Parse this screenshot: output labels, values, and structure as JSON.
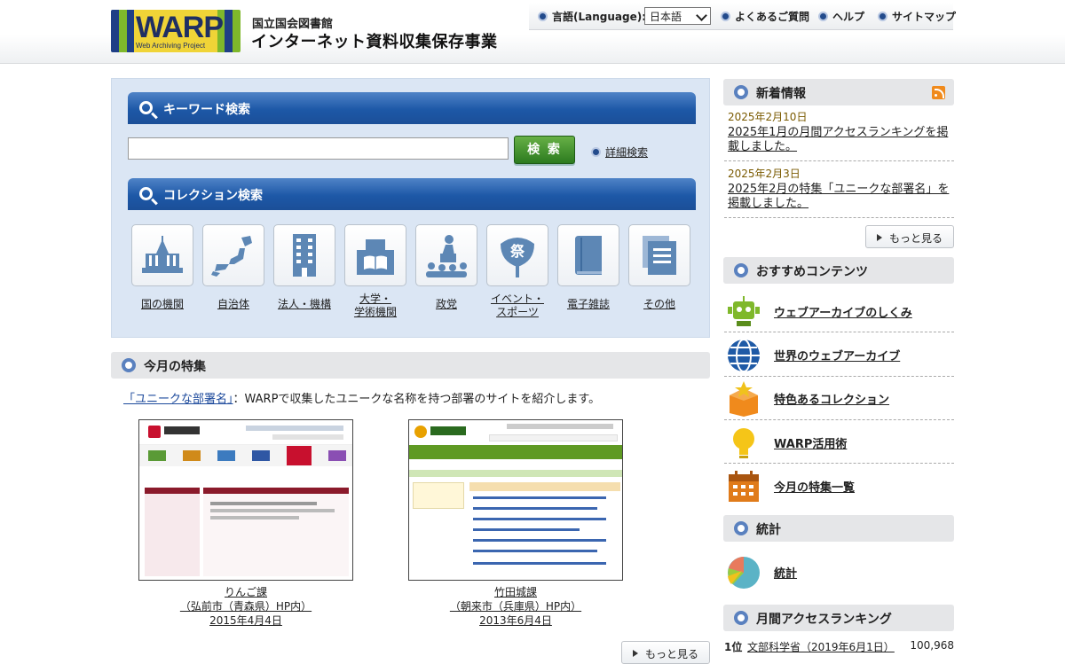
{
  "header": {
    "logo_text": "WARP",
    "logo_sub": "Web Archiving Project",
    "org_name": "国立国会図書館",
    "project_name": "インターネット資料収集保存事業",
    "language_label": "言語(Language):",
    "language_value": "日本語",
    "faq": "よくあるご質問",
    "help": "ヘルプ",
    "sitemap": "サイトマップ"
  },
  "search": {
    "keyword_title": "キーワード検索",
    "search_button": "検 索",
    "advanced": "詳細検索",
    "collection_title": "コレクション検索",
    "categories": [
      {
        "label": "国の機関",
        "icon": "government-building-icon"
      },
      {
        "label": "自治体",
        "icon": "japan-map-icon"
      },
      {
        "label": "法人・機構",
        "icon": "office-building-icon"
      },
      {
        "label": "大学・\n学術機関",
        "icon": "university-book-icon"
      },
      {
        "label": "政党",
        "icon": "speaker-podium-icon"
      },
      {
        "label": "イベント・\nスポーツ",
        "icon": "festival-fan-icon"
      },
      {
        "label": "電子雑誌",
        "icon": "magazine-icon"
      },
      {
        "label": "その他",
        "icon": "documents-icon"
      }
    ]
  },
  "feature": {
    "title": "今月の特集",
    "link_text": "「ユニークな部署名」",
    "desc": "：WARPで収集したユニークな名称を持つ部署のサイトを紹介します。",
    "items": [
      {
        "name": "りんご課",
        "site": "（弘前市（青森県）HP内）",
        "date": "2015年4月4日"
      },
      {
        "name": "竹田城課",
        "site": "（朝来市（兵庫県）HP内）",
        "date": "2013年6月4日"
      }
    ],
    "more": "もっと見る"
  },
  "news": {
    "title": "新着情報",
    "items": [
      {
        "date": "2025年2月10日",
        "text": "2025年1月の月間アクセスランキングを掲載しました。"
      },
      {
        "date": "2025年2月3日",
        "text": "2025年2月の特集「ユニークな部署名」を掲載しました。"
      }
    ],
    "more": "もっと見る"
  },
  "recommend": {
    "title": "おすすめコンテンツ",
    "items": [
      {
        "label": "ウェブアーカイブのしくみ",
        "icon": "robot-icon"
      },
      {
        "label": "世界のウェブアーカイブ",
        "icon": "globe-icon"
      },
      {
        "label": "特色あるコレクション",
        "icon": "star-box-icon"
      },
      {
        "label": "WARP活用術",
        "icon": "lightbulb-icon"
      },
      {
        "label": "今月の特集一覧",
        "icon": "calendar-icon"
      }
    ]
  },
  "stats": {
    "title": "統計",
    "link": "統計",
    "icon": "pie-chart-icon"
  },
  "ranking": {
    "title": "月間アクセスランキング",
    "items": [
      {
        "rank": "1位",
        "name": "文部科学省（2019年6月1日）",
        "count": "100,968"
      }
    ]
  },
  "colors": {
    "accent_blue": "#1d58a7",
    "search_green": "#2c7b1f",
    "panel_bg": "#dbe6f4"
  }
}
